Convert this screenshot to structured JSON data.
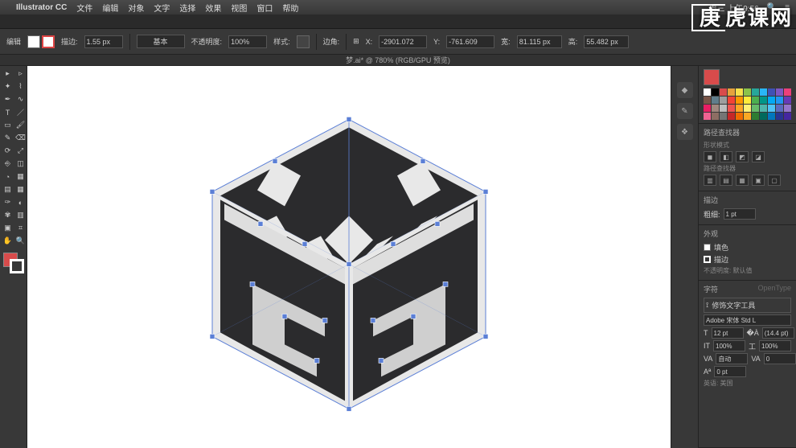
{
  "mac_menu": {
    "apple": "",
    "app": "Illustrator CC",
    "items": [
      "文件",
      "编辑",
      "对象",
      "文字",
      "选择",
      "效果",
      "视图",
      "窗口",
      "帮助"
    ],
    "right": {
      "status": "周三 上午9:56",
      "search": ""
    }
  },
  "control_bar": {
    "edit_label": "编辑",
    "stroke_label": "描边:",
    "stroke_val": "1.55 px",
    "uniform_label": "基本",
    "opacity_label": "不透明度:",
    "opacity_val": "100%",
    "style_label": "样式:",
    "corner_label": "边角:",
    "x_label": "X:",
    "x_val": "-2901.072",
    "y_label": "Y:",
    "y_val": "-761.609",
    "w_label": "宽:",
    "w_val": "81.115 px",
    "h_label": "高:",
    "h_val": "55.482 px"
  },
  "doc_tab": "梦.ai* @ 780% (RGB/GPU 预览)",
  "tools": [
    {
      "name": "selection-tool",
      "glyph": "▸"
    },
    {
      "name": "direct-selection-tool",
      "glyph": "▹"
    },
    {
      "name": "magic-wand-tool",
      "glyph": "✦"
    },
    {
      "name": "lasso-tool",
      "glyph": "⌇"
    },
    {
      "name": "pen-tool",
      "glyph": "✒"
    },
    {
      "name": "curvature-tool",
      "glyph": "∿"
    },
    {
      "name": "type-tool",
      "glyph": "T"
    },
    {
      "name": "line-tool",
      "glyph": "／"
    },
    {
      "name": "rectangle-tool",
      "glyph": "▭"
    },
    {
      "name": "paintbrush-tool",
      "glyph": "🖌"
    },
    {
      "name": "pencil-tool",
      "glyph": "✎"
    },
    {
      "name": "eraser-tool",
      "glyph": "⌫"
    },
    {
      "name": "rotate-tool",
      "glyph": "⟳"
    },
    {
      "name": "scale-tool",
      "glyph": "⤢"
    },
    {
      "name": "width-tool",
      "glyph": "⎆"
    },
    {
      "name": "free-transform-tool",
      "glyph": "◫"
    },
    {
      "name": "shape-builder-tool",
      "glyph": "◔"
    },
    {
      "name": "perspective-tool",
      "glyph": "▦"
    },
    {
      "name": "mesh-tool",
      "glyph": "▤"
    },
    {
      "name": "gradient-tool",
      "glyph": "▦"
    },
    {
      "name": "eyedropper-tool",
      "glyph": "✑"
    },
    {
      "name": "blend-tool",
      "glyph": "◐"
    },
    {
      "name": "symbol-sprayer-tool",
      "glyph": "✾"
    },
    {
      "name": "column-graph-tool",
      "glyph": "▥"
    },
    {
      "name": "artboard-tool",
      "glyph": "▣"
    },
    {
      "name": "slice-tool",
      "glyph": "⌗"
    },
    {
      "name": "hand-tool",
      "glyph": "✋"
    },
    {
      "name": "zoom-tool",
      "glyph": "🔍"
    }
  ],
  "swatches": [
    "#ffffff",
    "#000000",
    "#d84b4b",
    "#e6a23c",
    "#f7e04b",
    "#8bc34a",
    "#26a69a",
    "#29b6f6",
    "#3f51b5",
    "#7e57c2",
    "#ec407a",
    "#795548",
    "#607d8b",
    "#9e9e9e",
    "#f44336",
    "#ff9800",
    "#ffeb3b",
    "#4caf50",
    "#009688",
    "#03a9f4",
    "#2196f3",
    "#673ab7",
    "#e91e63",
    "#a1887f",
    "#bdbdbd",
    "#ef5350",
    "#ffa726",
    "#fff176",
    "#66bb6a",
    "#4db6ac",
    "#4fc3f7",
    "#5c6bc0",
    "#9575cd",
    "#f06292",
    "#8d6e63",
    "#757575",
    "#c62828",
    "#ef6c00",
    "#f9a825",
    "#2e7d32",
    "#00695c",
    "#0277bd",
    "#283593",
    "#4527a0"
  ],
  "panels": {
    "tab_props": "路径查找器",
    "blend_mode_title": "形状模式",
    "pathfinder_title": "路径查找器",
    "stroke_title": "描边",
    "stroke_weight": "粗细:",
    "stroke_val": "1 pt",
    "appearance_title": "外观",
    "appearance_fill": "填色",
    "appearance_stroke": "描边",
    "appearance_opacity": "不透明度: 默认值",
    "char_title": "字符",
    "opentype": "OpenType",
    "touch_type": "修饰文字工具",
    "font_name": "Adobe 宋体 Std L",
    "font_size": "12 pt",
    "leading": "(14.4 pt)",
    "tracking": "100%",
    "kerning": "0",
    "baseline": "0 pt",
    "auto_label": "自动",
    "lang_label": "英语: 美国"
  },
  "watermark": "虎课网"
}
